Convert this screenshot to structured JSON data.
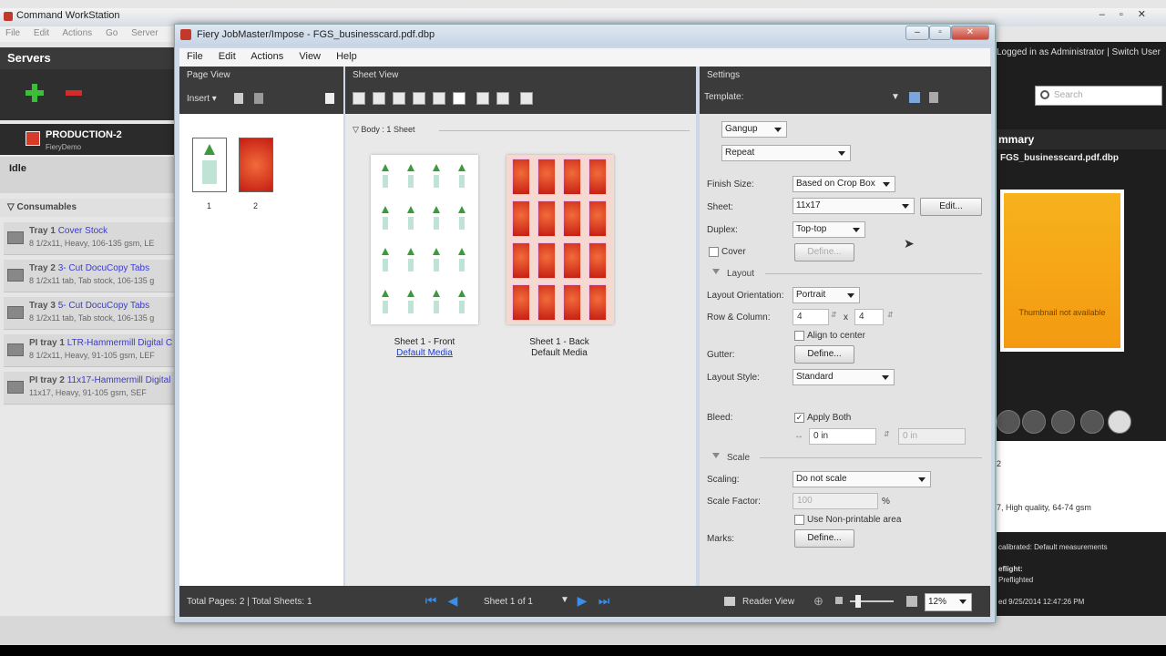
{
  "cws": {
    "title": "Command WorkStation",
    "menu": [
      "File",
      "Edit",
      "Actions",
      "Go",
      "Server"
    ],
    "servers_title": "Servers",
    "server_name": "PRODUCTION-2",
    "server_sub": "FieryDemo",
    "status": "Idle",
    "consumables": "Consumables",
    "trays": [
      {
        "name": "Tray 1",
        "media": "Cover Stock",
        "desc": "8 1/2x11, Heavy, 106-135 gsm, LE"
      },
      {
        "name": "Tray 2",
        "media": "3- Cut DocuCopy Tabs",
        "desc": "8 1/2x11 tab, Tab stock, 106-135 g"
      },
      {
        "name": "Tray 3",
        "media": "5- Cut DocuCopy Tabs",
        "desc": "8 1/2x11 tab, Tab stock, 106-135 g"
      },
      {
        "name": "PI tray 1",
        "media": "LTR-Hammermill Digital C",
        "desc": "8 1/2x11, Heavy, 91-105 gsm, LEF"
      },
      {
        "name": "PI tray 2",
        "media": "11x17-Hammermill Digital",
        "desc": "11x17, Heavy, 91-105 gsm, SEF"
      }
    ],
    "logged_in": "Logged in as Administrator | Switch User",
    "search_placeholder": "Search",
    "summary_title": "mmary",
    "summary_file": "FGS_businesscard.pdf.dbp",
    "thumbnail_na": "Thumbnail not available",
    "info_lines": [
      "2",
      "7, High quality, 64-74 gsm"
    ],
    "info2_lines": [
      "calibrated: Default measurements",
      "eflight:",
      "Preflighted",
      "ed 9/25/2014 12:47:26 PM"
    ]
  },
  "impose": {
    "title": "Fiery JobMaster/Impose - FGS_businesscard.pdf.dbp",
    "menu": [
      "File",
      "Edit",
      "Actions",
      "View",
      "Help"
    ],
    "page_view": {
      "title": "Page View",
      "insert": "Insert",
      "pages": [
        "1",
        "2"
      ]
    },
    "sheet_view": {
      "title": "Sheet View",
      "body_label": "Body : 1 Sheet",
      "front_label": "Sheet 1 - Front",
      "front_media": "Default Media",
      "back_label": "Sheet 1 - Back",
      "back_media": "Default Media"
    },
    "settings": {
      "title": "Settings",
      "template_label": "Template:",
      "gangup": "Gangup",
      "repeat": "Repeat",
      "finish_size_label": "Finish Size:",
      "finish_size": "Based on Crop Box",
      "sheet_label": "Sheet:",
      "sheet": "11x17",
      "edit": "Edit...",
      "duplex_label": "Duplex:",
      "duplex": "Top-top",
      "cover_label": "Cover",
      "define": "Define...",
      "layout_section": "Layout",
      "orientation_label": "Layout Orientation:",
      "orientation": "Portrait",
      "row_col_label": "Row & Column:",
      "rows": "4",
      "x": "x",
      "cols": "4",
      "align_center": "Align to center",
      "gutter_label": "Gutter:",
      "layout_style_label": "Layout Style:",
      "layout_style": "Standard",
      "bleed_label": "Bleed:",
      "apply_both": "Apply Both",
      "bleed_1": "0 in",
      "bleed_2": "0 in",
      "scale_section": "Scale",
      "scaling_label": "Scaling:",
      "scaling": "Do not scale",
      "scale_factor_label": "Scale Factor:",
      "scale_factor": "100",
      "percent": "%",
      "non_printable": "Use Non-printable area",
      "marks_label": "Marks:"
    },
    "status": {
      "totals": "Total Pages: 2 | Total Sheets: 1",
      "sheet_nav": "Sheet 1 of 1",
      "reader_view": "Reader View",
      "zoom": "12%"
    }
  }
}
